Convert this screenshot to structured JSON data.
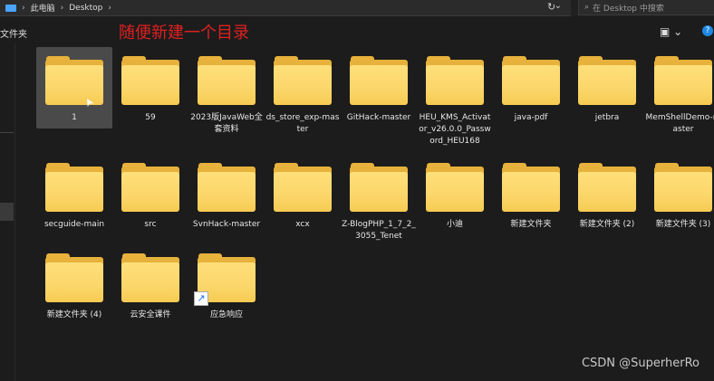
{
  "address_bar": {
    "segments": [
      "此电脑",
      "Desktop"
    ],
    "dropdown": "⌄"
  },
  "search": {
    "placeholder": "在 Desktop 中搜索"
  },
  "toolbar": {
    "left_label": "文件夹",
    "view_button": "▣ ⌄",
    "help": "?"
  },
  "annotation": "随便新建一个目录",
  "watermark": "CSDN @SuperherRo",
  "folders": [
    {
      "label": "1",
      "selected": true
    },
    {
      "label": "59"
    },
    {
      "label": "2023版JavaWeb全套资料"
    },
    {
      "label": "ds_store_exp-master"
    },
    {
      "label": "GitHack-master"
    },
    {
      "label": "HEU_KMS_Activator_v26.0.0_Password_HEU168"
    },
    {
      "label": "java-pdf"
    },
    {
      "label": "jetbra"
    },
    {
      "label": "MemShellDemo-master"
    },
    {
      "label": "secguide-main"
    },
    {
      "label": "src"
    },
    {
      "label": "SvnHack-master"
    },
    {
      "label": "xcx"
    },
    {
      "label": "Z-BlogPHP_1_7_2_3055_Tenet"
    },
    {
      "label": "小迪"
    },
    {
      "label": "新建文件夹"
    },
    {
      "label": "新建文件夹 (2)"
    },
    {
      "label": "新建文件夹 (3)"
    },
    {
      "label": "新建文件夹 (4)"
    },
    {
      "label": "云安全课件"
    },
    {
      "label": "应急响应",
      "shortcut": true
    }
  ]
}
